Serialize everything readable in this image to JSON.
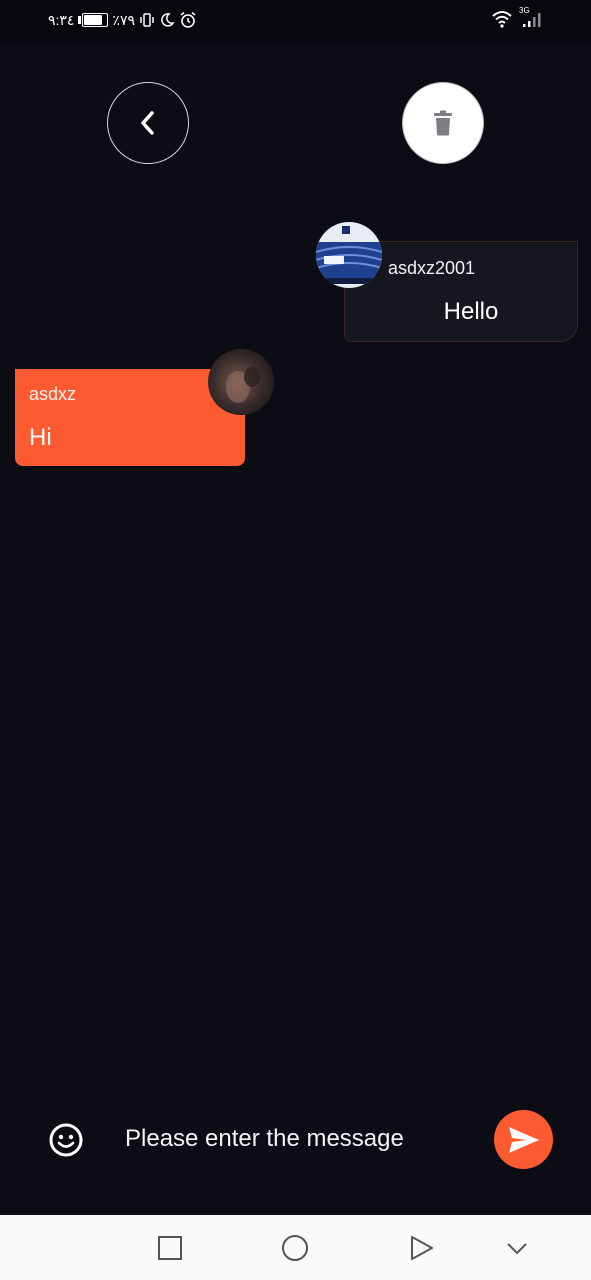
{
  "status_bar": {
    "time": "٩:٣٤",
    "battery_percent": "٪٧٩",
    "battery_level": 0.79,
    "network_type": "3G",
    "icons": [
      "battery-icon",
      "vibrate-icon",
      "moon-icon",
      "alarm-icon",
      "wifi-icon",
      "signal-icon"
    ]
  },
  "header": {
    "back_icon": "chevron-left-icon",
    "delete_icon": "trash-icon"
  },
  "messages": [
    {
      "sender": "asdxz2001",
      "text": "Hello",
      "side": "right",
      "avatar": "avatar-photo-icon"
    },
    {
      "sender": "asdxz",
      "text": "Hi",
      "side": "left",
      "avatar": "avatar-photo-icon"
    }
  ],
  "composer": {
    "placeholder": "Please enter the message",
    "value": "",
    "emoji_icon": "smiley-icon",
    "send_icon": "send-icon"
  },
  "nav_bar": {
    "icons": [
      "recents-square-icon",
      "home-circle-icon",
      "back-triangle-icon",
      "hide-chevron-down-icon"
    ]
  },
  "colors": {
    "background": "#0c0d14",
    "accent": "#fd5a32",
    "bubble_dark": "#16161e"
  }
}
